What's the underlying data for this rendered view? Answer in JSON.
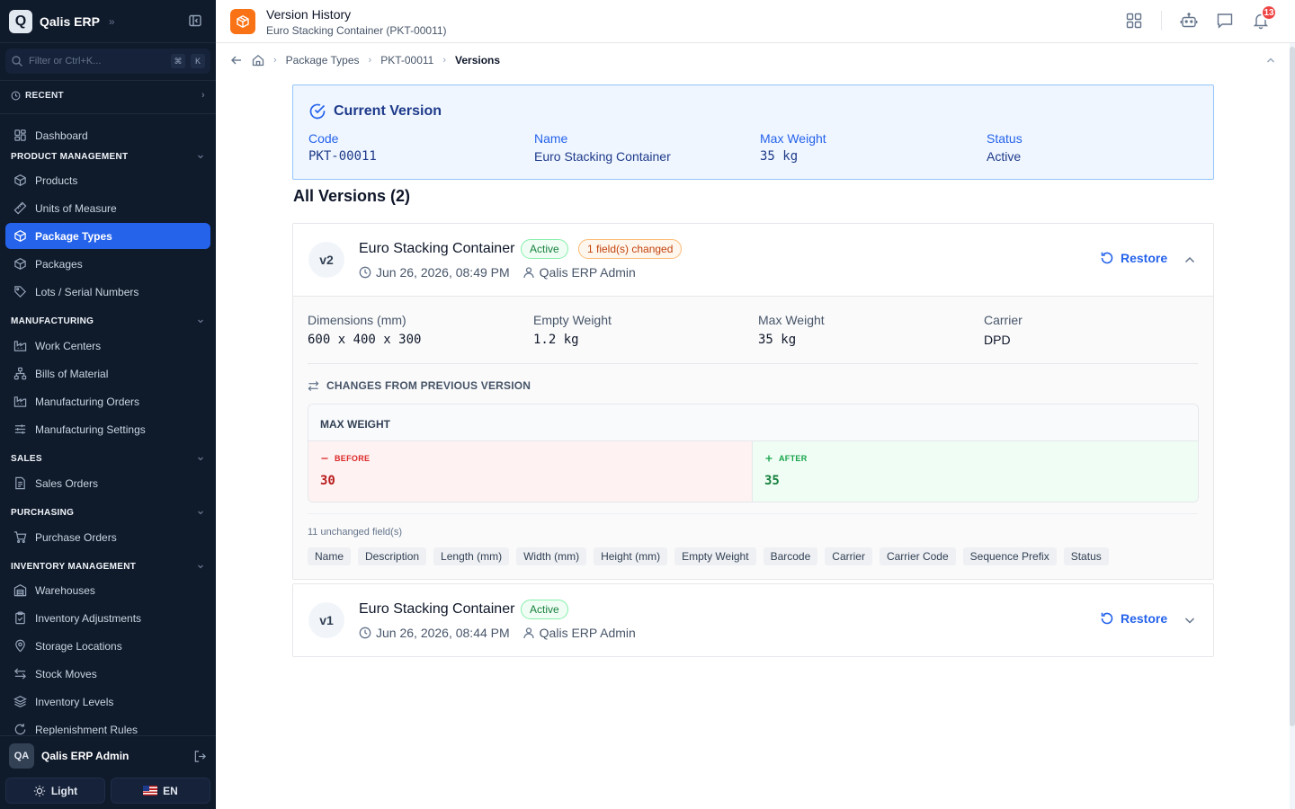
{
  "sidebar": {
    "brand": {
      "logo_letter": "Q",
      "name": "Qalis ERP",
      "chevron": "»"
    },
    "filter": {
      "placeholder": "Filter or Ctrl+K...",
      "kbd1": "⌘",
      "kbd2": "K"
    },
    "recent_label": "RECENT",
    "items": {
      "dashboard": "Dashboard",
      "products": "Products",
      "units_of_measure": "Units of Measure",
      "package_types": "Package Types",
      "packages": "Packages",
      "lots_serial": "Lots / Serial Numbers",
      "work_centers": "Work Centers",
      "bills_of_material": "Bills of Material",
      "manufacturing_orders": "Manufacturing Orders",
      "manufacturing_settings": "Manufacturing Settings",
      "sales_orders": "Sales Orders",
      "purchase_orders": "Purchase Orders",
      "warehouses": "Warehouses",
      "inventory_adjustments": "Inventory Adjustments",
      "storage_locations": "Storage Locations",
      "stock_moves": "Stock Moves",
      "inventory_levels": "Inventory Levels",
      "replenishment_rules": "Replenishment Rules"
    },
    "sections": {
      "product_management": "PRODUCT MANAGEMENT",
      "manufacturing": "MANUFACTURING",
      "sales": "SALES",
      "purchasing": "PURCHASING",
      "inventory_management": "INVENTORY MANAGEMENT"
    },
    "user": {
      "initials": "QA",
      "name": "Qalis ERP Admin"
    },
    "theme_label": "Light",
    "language_label": "EN"
  },
  "header": {
    "title": "Version History",
    "subtitle": "Euro Stacking Container (PKT-00011)",
    "notification_count": "13",
    "accent": "#f97316"
  },
  "breadcrumb": {
    "items": [
      "Package Types",
      "PKT-00011",
      "Versions"
    ]
  },
  "current_version": {
    "title": "Current Version",
    "fields": [
      {
        "label": "Code",
        "value": "PKT-00011"
      },
      {
        "label": "Name",
        "value": "Euro Stacking Container"
      },
      {
        "label": "Max Weight",
        "value": "35 kg"
      },
      {
        "label": "Status",
        "value": "Active"
      }
    ]
  },
  "all_versions_title": "All Versions (2)",
  "versions": [
    {
      "badge": "v2",
      "name": "Euro Stacking Container",
      "status": "Active",
      "changed_badge": "1 field(s) changed",
      "date": "Jun 26, 2026, 08:49 PM",
      "author": "Qalis ERP Admin",
      "restore_label": "Restore",
      "expanded": true,
      "fields": [
        {
          "label": "Dimensions (mm)",
          "value": "600 x 400 x 300"
        },
        {
          "label": "Empty Weight",
          "value": "1.2 kg"
        },
        {
          "label": "Max Weight",
          "value": "35 kg"
        },
        {
          "label": "Carrier",
          "value": "DPD"
        }
      ],
      "changes_title": "CHANGES FROM PREVIOUS VERSION",
      "change": {
        "field": "MAX WEIGHT",
        "before_label": "BEFORE",
        "before_value": "30",
        "after_label": "AFTER",
        "after_value": "35"
      },
      "unchanged_label": "11 unchanged field(s)",
      "unchanged_fields": [
        "Name",
        "Description",
        "Length (mm)",
        "Width (mm)",
        "Height (mm)",
        "Empty Weight",
        "Barcode",
        "Carrier",
        "Carrier Code",
        "Sequence Prefix",
        "Status"
      ]
    },
    {
      "badge": "v1",
      "name": "Euro Stacking Container",
      "status": "Active",
      "date": "Jun 26, 2026, 08:44 PM",
      "author": "Qalis ERP Admin",
      "restore_label": "Restore",
      "expanded": false
    }
  ]
}
